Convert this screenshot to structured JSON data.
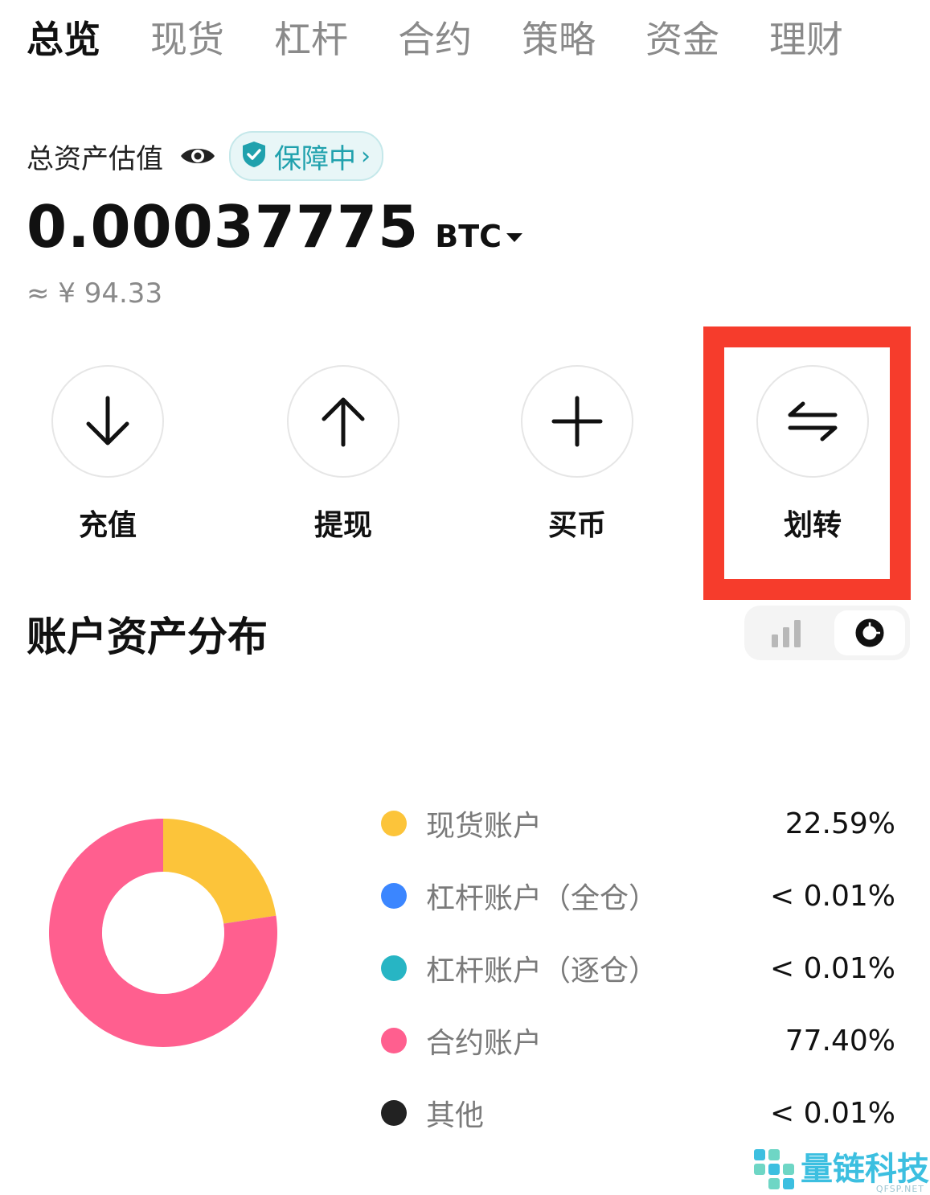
{
  "tabs": [
    {
      "label": "总览",
      "active": true
    },
    {
      "label": "现货"
    },
    {
      "label": "杠杆"
    },
    {
      "label": "合约"
    },
    {
      "label": "策略"
    },
    {
      "label": "资金"
    },
    {
      "label": "理财"
    }
  ],
  "overview": {
    "label": "总资产估值",
    "eye_icon": "eye-icon",
    "badge": {
      "label": "保障中",
      "icon": "shield-check-icon",
      "chevron": "›"
    },
    "amount": "0.00037775",
    "unit": "BTC",
    "approx": "≈ ¥ 94.33"
  },
  "actions": [
    {
      "label": "充值",
      "icon": "arrow-down-icon"
    },
    {
      "label": "提现",
      "icon": "arrow-up-icon"
    },
    {
      "label": "买币",
      "icon": "plus-icon"
    },
    {
      "label": "划转",
      "icon": "transfer-icon",
      "highlighted": true
    }
  ],
  "distribution": {
    "title": "账户资产分布",
    "view_toggle": {
      "options": [
        "bar-chart-icon",
        "donut-chart-icon"
      ],
      "selected": "donut-chart-icon"
    },
    "legend": [
      {
        "name": "现货账户",
        "value": "22.59%",
        "color": "#fcc43a"
      },
      {
        "name": "杠杆账户（全仓）",
        "value": "< 0.01%",
        "color": "#3b86ff"
      },
      {
        "name": "杠杆账户（逐仓）",
        "value": "< 0.01%",
        "color": "#27b5c4"
      },
      {
        "name": "合约账户",
        "value": "77.40%",
        "color": "#ff5f8f"
      },
      {
        "name": "其他",
        "value": "< 0.01%",
        "color": "#222222"
      }
    ]
  },
  "chart_data": {
    "type": "pie",
    "categories": [
      "现货账户",
      "杠杆账户（全仓）",
      "杠杆账户（逐仓）",
      "合约账户",
      "其他"
    ],
    "values": [
      22.59,
      0.005,
      0.005,
      77.4,
      0.005
    ],
    "colors": [
      "#fcc43a",
      "#3b86ff",
      "#27b5c4",
      "#ff5f8f",
      "#222222"
    ],
    "donut": true
  },
  "watermark": {
    "label": "量链科技",
    "sub": "QFSP.NET"
  },
  "colors": {
    "highlight": "#f63c2c",
    "badge_text": "#20a1ad"
  }
}
